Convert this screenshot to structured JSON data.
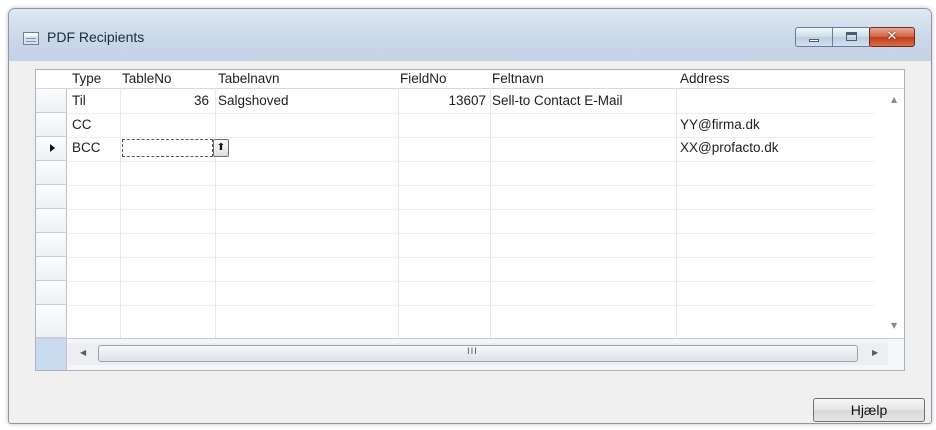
{
  "window": {
    "title": "PDF Recipients",
    "controls": {
      "minimize": "–",
      "maximize": "□",
      "close": "✕"
    }
  },
  "grid": {
    "columns": [
      "Type",
      "TableNo",
      "Tabelnavn",
      "FieldNo",
      "Feltnavn",
      "Address"
    ],
    "rows": [
      {
        "type": "Til",
        "table_no": "36",
        "tabelnavn": "Salgshoved",
        "field_no": "13607",
        "feltnavn": "Sell-to Contact E-Mail",
        "address": ""
      },
      {
        "type": "CC",
        "table_no": "",
        "tabelnavn": "",
        "field_no": "",
        "feltnavn": "",
        "address": "YY@firma.dk"
      },
      {
        "type": "BCC",
        "table_no": "",
        "tabelnavn": "",
        "field_no": "",
        "feltnavn": "",
        "address": "XX@profacto.dk"
      }
    ],
    "current_row": 3,
    "lookup_glyph": "⬆",
    "scroll": {
      "up": "▲",
      "down": "▼",
      "left": "◀",
      "right": "▶",
      "grip": "III"
    }
  },
  "buttons": {
    "help": "Hjælp"
  }
}
